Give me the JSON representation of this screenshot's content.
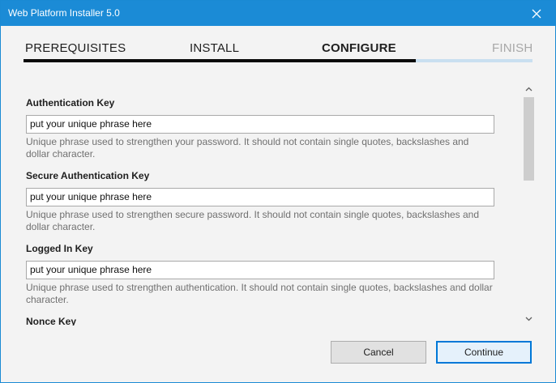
{
  "window": {
    "title": "Web Platform Installer 5.0"
  },
  "steps": [
    {
      "label": "PREREQUISITES",
      "state": "done"
    },
    {
      "label": "INSTALL",
      "state": "done"
    },
    {
      "label": "CONFIGURE",
      "state": "current"
    },
    {
      "label": "FINISH",
      "state": "future"
    }
  ],
  "progress_percent": 77,
  "fields": [
    {
      "label": "Authentication Key",
      "value": "put your unique phrase here",
      "help": "Unique phrase used to strengthen your password. It should not contain single quotes, backslashes and dollar character."
    },
    {
      "label": "Secure Authentication Key",
      "value": "put your unique phrase here",
      "help": "Unique phrase used to strengthen secure password. It should not contain single quotes, backslashes and dollar character."
    },
    {
      "label": "Logged In Key",
      "value": "put your unique phrase here",
      "help": "Unique phrase used to strengthen authentication. It should not contain single quotes, backslashes and dollar character."
    },
    {
      "label": "Nonce Key"
    }
  ],
  "buttons": {
    "cancel_label": "Cancel",
    "continue_label": "Continue"
  },
  "icons": {
    "close": "close-icon",
    "scroll_up": "chevron-up-icon",
    "scroll_down": "chevron-down-icon"
  },
  "colors": {
    "titlebar": "#1b8bd6",
    "progress_done": "#0a0a0a",
    "progress_remaining": "#c9dff0",
    "primary_border": "#0078d7"
  }
}
